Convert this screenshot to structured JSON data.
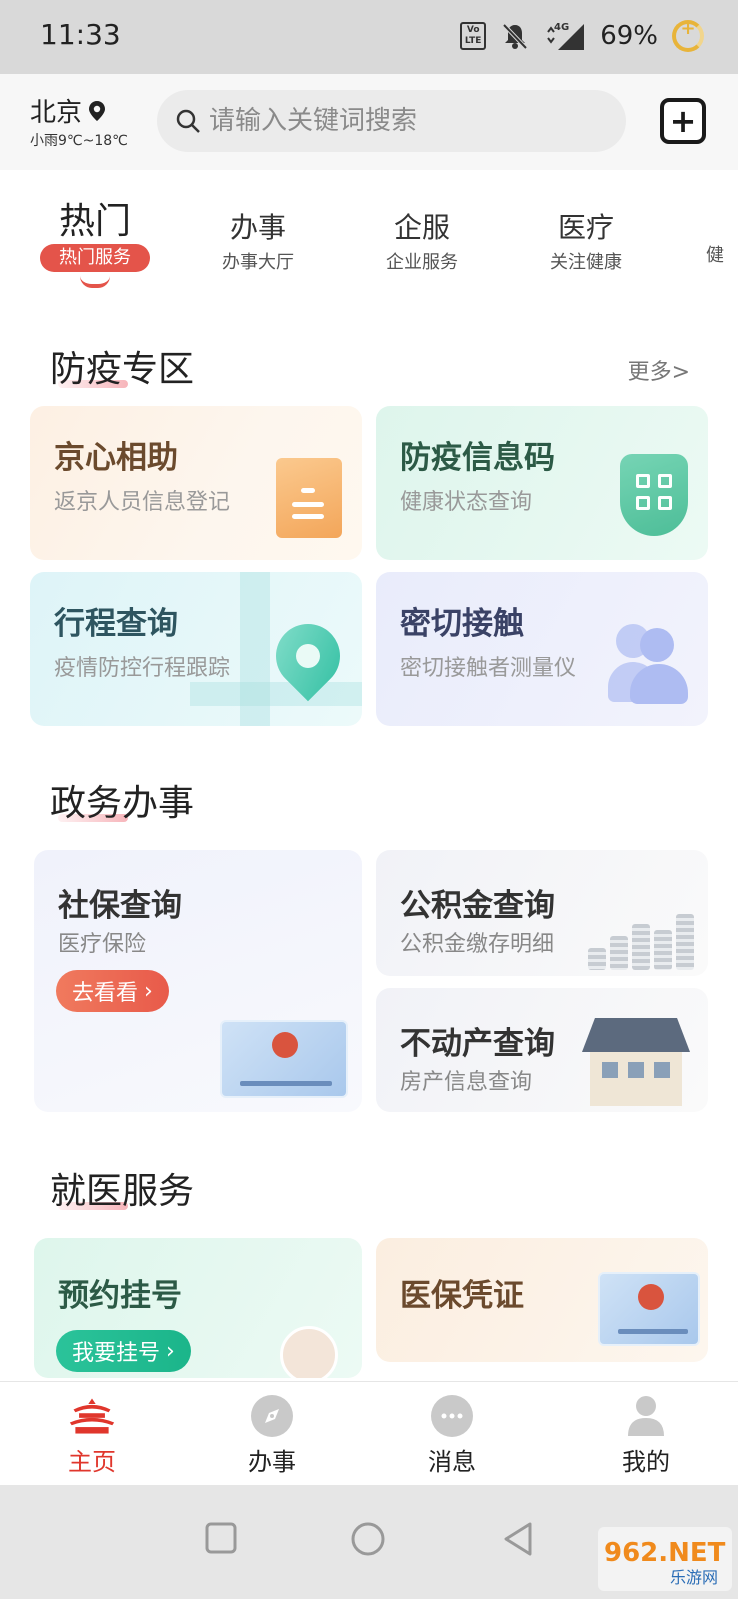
{
  "status_bar": {
    "time": "11:33",
    "volte": "Vo\nLTE",
    "network": "4G",
    "battery": "69%"
  },
  "header": {
    "city": "北京",
    "weather": "小雨9℃~18℃",
    "search_placeholder": "请输入关键词搜索"
  },
  "tabs": [
    {
      "main": "热门",
      "sub": "热门服务",
      "active": true
    },
    {
      "main": "办事",
      "sub": "办事大厅"
    },
    {
      "main": "企服",
      "sub": "企业服务"
    },
    {
      "main": "医疗",
      "sub": "关注健康"
    },
    {
      "main": "",
      "sub": "健"
    }
  ],
  "epidemic": {
    "title": "防疫专区",
    "more": "更多>",
    "cards": [
      {
        "title": "京心相助",
        "sub": "返京人员信息登记"
      },
      {
        "title": "防疫信息码",
        "sub": "健康状态查询"
      },
      {
        "title": "行程查询",
        "sub": "疫情防控行程跟踪"
      },
      {
        "title": "密切接触",
        "sub": "密切接触者测量仪"
      }
    ]
  },
  "gov": {
    "title": "政务办事",
    "social": {
      "title": "社保查询",
      "sub": "医疗保险",
      "button": "去看看"
    },
    "fund": {
      "title": "公积金查询",
      "sub": "公积金缴存明细"
    },
    "estate": {
      "title": "不动产查询",
      "sub": "房产信息查询"
    }
  },
  "medical": {
    "title": "就医服务",
    "appointment": {
      "title": "预约挂号",
      "button": "我要挂号"
    },
    "insurance": {
      "title": "医保凭证"
    }
  },
  "bottom_nav": [
    {
      "label": "主页",
      "active": true
    },
    {
      "label": "办事"
    },
    {
      "label": "消息"
    },
    {
      "label": "我的"
    }
  ],
  "watermark": {
    "text": "962.NET",
    "sub": "乐游网"
  },
  "colors": {
    "accent": "#e0362c",
    "green": "#1bb58a"
  }
}
